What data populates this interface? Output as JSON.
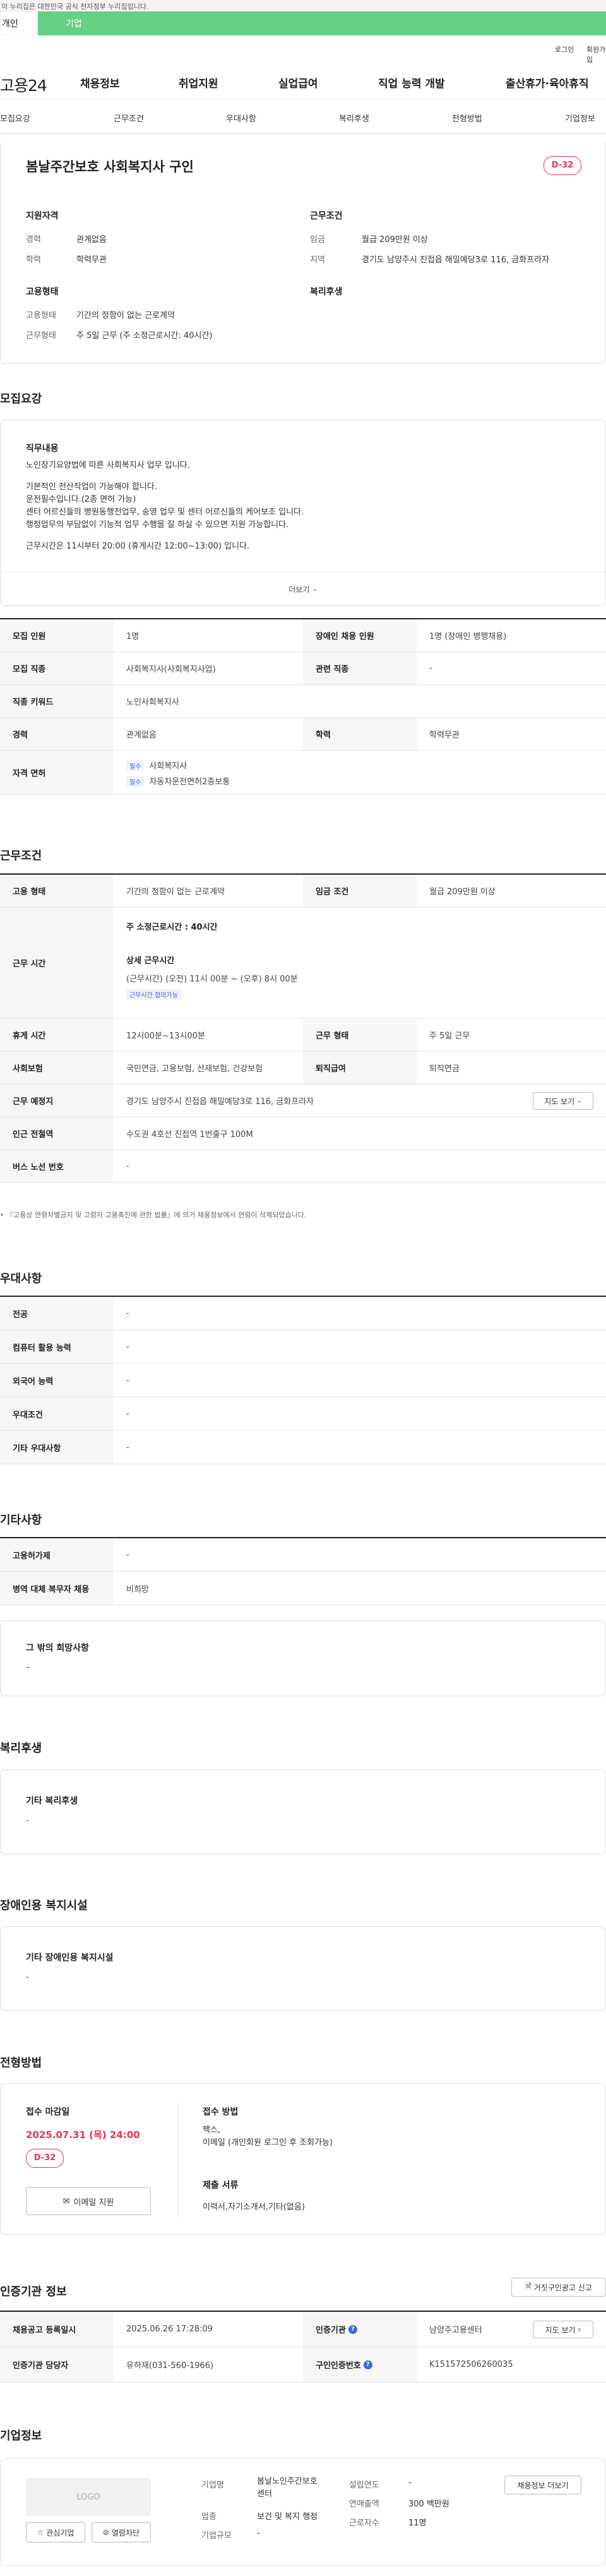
{
  "header": {
    "notice": "이 누리집은 대한민국 공식 전자정부 누리집입니다.",
    "user_tabs": [
      "개인",
      "기업"
    ],
    "util_links": [
      "로그인",
      "회원가입"
    ],
    "logo": "고용24",
    "gnb": [
      "채용정보",
      "취업지원",
      "실업급여",
      "직업 능력 개발",
      "출산휴가·육아휴직"
    ]
  },
  "anchors": [
    "모집요강",
    "근무조건",
    "우대사항",
    "복리후생",
    "전형방법",
    "기업정보"
  ],
  "summary": {
    "title": "봄날주간보호 사회복지사 구인",
    "dday": "D-32",
    "qual_title": "지원자격",
    "cond_title": "근무조건",
    "type_title": "고용형태",
    "welfare_title": "복리후생",
    "career_label": "경력",
    "career_value": "관계없음",
    "edu_label": "학력",
    "edu_value": "학력무관",
    "wage_label": "임금",
    "wage_value": "월급 209만원 이상",
    "region_label": "지역",
    "region_value": "경기도 남양주시 진접읍 해밀예당3로 116, 금화프라자",
    "emp_label": "고용형태",
    "emp_value": "기간의 정함이 없는 근로계약",
    "work_label": "근무형태",
    "work_value": "주 5일 근무 (주 소정근로시간: 40시간)"
  },
  "recruit": {
    "section_title": "모집요강",
    "job_title": "직무내용",
    "job_lines": [
      "노인장기요양법에 따른 사회복지사 업무 입니다.",
      "",
      "기본적인 전산작업이 가능해야 합니다.",
      "운전필수입니다.(2종 면허 가능)",
      "센터 어르신들의 병원동행전업무, 송영 업무 및 센터 어르신들의 케어보조 입니다.",
      "행정업무의 부담없이 기능적 업무 수행을 잘 하실 수 있으면 지원 가능합니다.",
      "",
      "근무시간은 11시부터 20:00 (휴게시간 12:00~13:00) 입니다."
    ],
    "more_label": "더보기",
    "rows": {
      "headcount_label": "모집 인원",
      "headcount": "1명",
      "disabled_label": "장애인 채용 인원",
      "disabled": "1명 (장애인 병행채용)",
      "occupation_label": "모집 직종",
      "occupation": "사회복지사(사회복지사업)",
      "related_label": "관련 직종",
      "related": "-",
      "keyword_label": "직종 키워드",
      "keyword": "노인사회복지사",
      "career_label": "경력",
      "career": "관계없음",
      "edu_label": "학력",
      "edu": "학력무관",
      "license_label": "자격 면허",
      "required_badge": "필수",
      "licenses": [
        "사회복지사",
        "자동차운전면허2종보통"
      ]
    }
  },
  "conditions": {
    "section_title": "근무조건",
    "emp_label": "고용 형태",
    "emp": "기간의 정함이 없는 근로계약",
    "wage_label": "임금 조건",
    "wage": "월급 209만원 이상",
    "hours_label": "근무 시간",
    "weekly_hours": "주 소정근로시간 : 40시간",
    "detail_title": "상세 근무시간",
    "detail_value": "(근무시간) (오전) 11시 00분 ~ (오후) 8시 00분",
    "negotiable": "근무시간 협의가능",
    "break_label": "휴게 시간",
    "break": "12시00분~13시00분",
    "worktype_label": "근무 형태",
    "worktype": "주 5일 근무",
    "insurance_label": "사회보험",
    "insurance": "국민연금, 고용보험, 산재보험, 건강보험",
    "severance_label": "퇴직급여",
    "severance": "퇴직연금",
    "place_label": "근무 예정지",
    "place": "경기도 남양주시 진접읍 해밀예당3로 116, 금화프라자",
    "map_btn": "지도 보기",
    "subway_label": "인근 전철역",
    "subway": "수도권 4호선 진접역 1번출구 100M",
    "bus_label": "버스 노선 번호",
    "bus": "-",
    "footnote": "『고용상 연령차별금지 및 고령자 고용촉진에 관한 법률』에 의거 채용정보에서 연령이 삭제되었습니다."
  },
  "preference": {
    "section_title": "우대사항",
    "rows": [
      {
        "label": "전공",
        "value": "-"
      },
      {
        "label": "컴퓨터 활용 능력",
        "value": "-"
      },
      {
        "label": "외국어 능력",
        "value": "-"
      },
      {
        "label": "우대조건",
        "value": "-"
      },
      {
        "label": "기타 우대사항",
        "value": "-"
      }
    ]
  },
  "etc": {
    "section_title": "기타사항",
    "rows": [
      {
        "label": "고용허가제",
        "value": "-"
      },
      {
        "label": "병역 대체 복무자 채용",
        "value": "비희망"
      }
    ],
    "hope_title": "그 밖의 희망사항",
    "hope_value": "-"
  },
  "welfare": {
    "section_title": "복리후생",
    "box_title": "기타 복리후생",
    "box_value": "-"
  },
  "disabled_fac": {
    "section_title": "장애인용 복지시설",
    "box_title": "기타 장애인용 복지시설",
    "box_value": "-"
  },
  "process": {
    "section_title": "전형방법",
    "deadline_title": "접수 마감일",
    "deadline": "2025.07.31 (목) 24:00",
    "dday": "D-32",
    "email_btn": "이메일 지원",
    "method_title": "접수 방법",
    "method_lines": [
      "팩스,",
      "이메일 (개인회원 로그인 후 조회가능)"
    ],
    "docs_title": "제출 서류",
    "docs": "이력서,자기소개서,기타(없음)"
  },
  "agency": {
    "section_title": "인증기관 정보",
    "report_btn": "거짓구인광고 신고",
    "reg_label": "채용공고 등록일시",
    "reg": "2025.06.26 17:28:09",
    "agency_label": "인증기관",
    "agency": "남양주고용센터",
    "map_btn": "지도 보기",
    "manager_label": "인증기관 담당자",
    "manager": "유하재(031-560-1966)",
    "number_label": "구인인증번호",
    "number": "K151572506260035"
  },
  "company": {
    "section_title": "기업정보",
    "logo_text": "LOGO",
    "fav_btn": "관심기업",
    "block_btn": "열람차단",
    "name_label": "기업명",
    "name_lines": [
      "봄날노인주간보호",
      "센터"
    ],
    "industry_label": "업종",
    "industry": "보건 및 복지 행정",
    "size_label": "기업규모",
    "size": "-",
    "year_label": "설립연도",
    "year": "-",
    "sales_label": "연매출액",
    "sales": "300 백만원",
    "employees_label": "근로자수",
    "employees": "11명",
    "jobs_btn": "채용정보 더보기"
  }
}
